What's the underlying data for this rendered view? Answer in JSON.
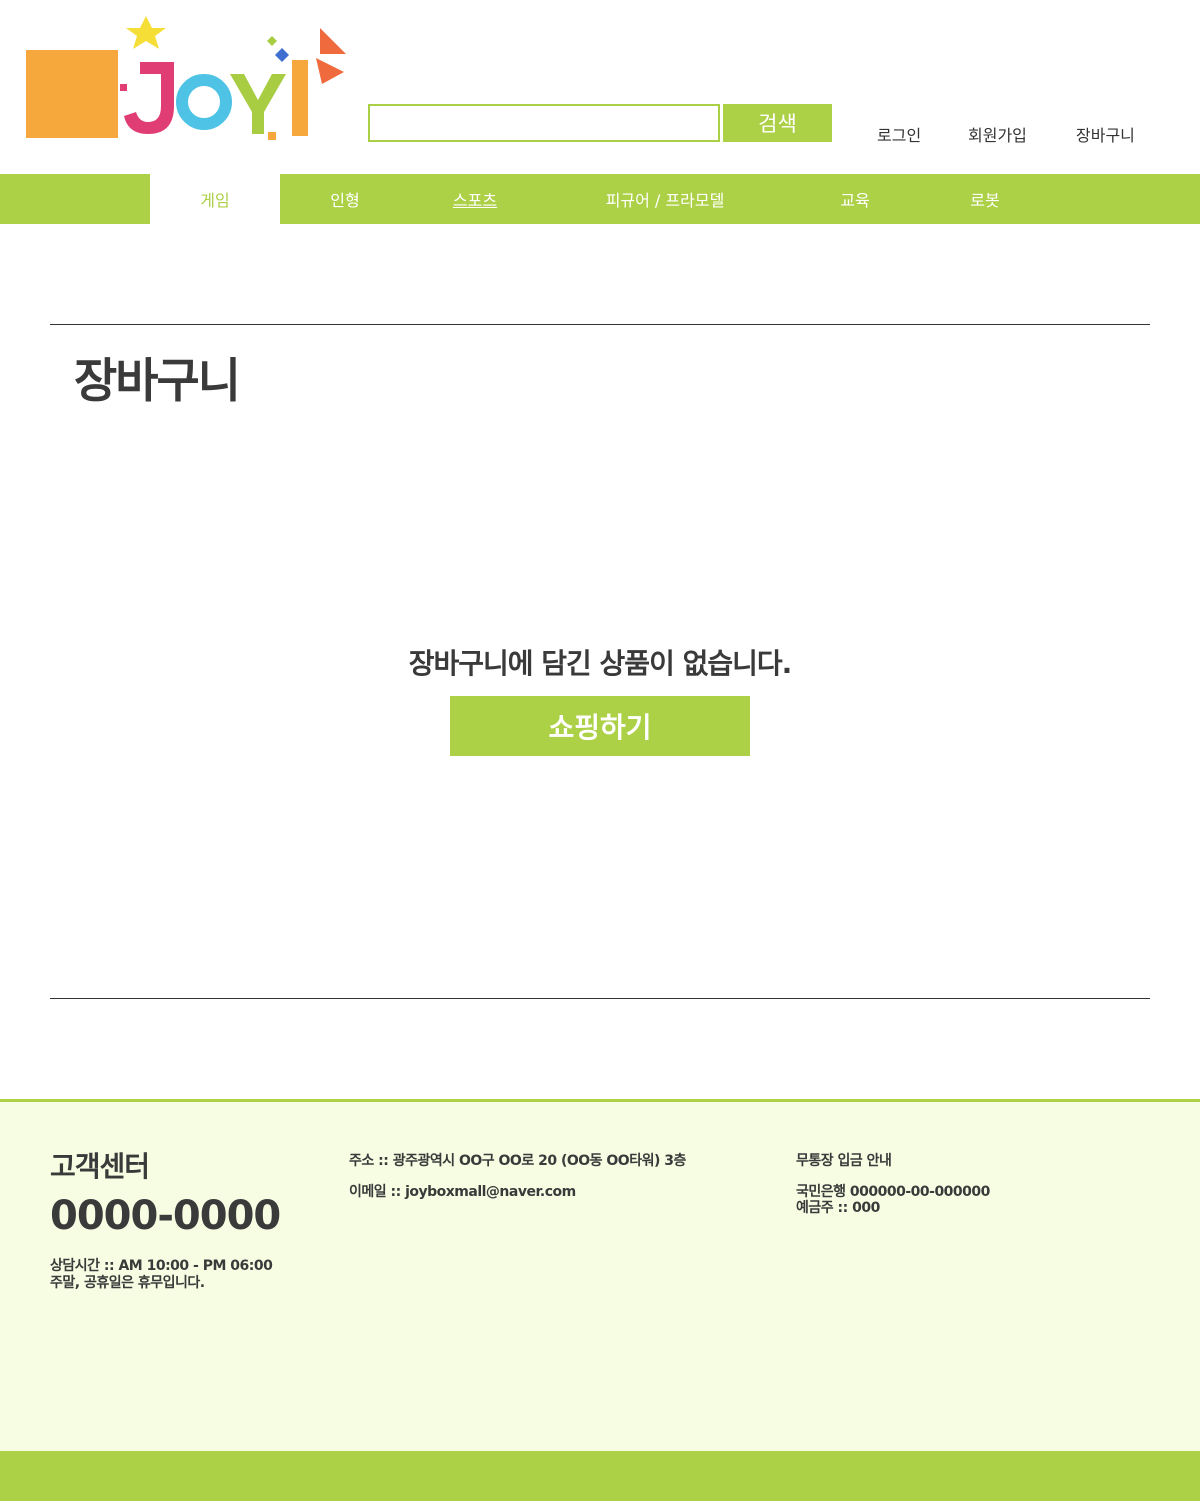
{
  "header": {
    "logo_text": "JOY!",
    "search": {
      "value": "",
      "placeholder": "",
      "button_label": "검색"
    },
    "util_links": [
      "로그인",
      "회원가입",
      "장바구니"
    ]
  },
  "nav": {
    "items": [
      "게임",
      "인형",
      "스포츠",
      "피규어 / 프라모델",
      "교육",
      "로봇"
    ],
    "active": "게임"
  },
  "main": {
    "title": "장바구니",
    "empty_message": "장바구니에 담긴 상품이 없습니다.",
    "shop_button": "쇼핑하기"
  },
  "footer": {
    "cs_title": "고객센터",
    "cs_phone": "0000-0000",
    "hours": "상담시간 :: AM 10:00 - PM 06:00",
    "holiday": "주말, 공휴일은 휴무입니다.",
    "address": "주소 :: 광주광역시 OO구 OO로 20 (OO동 OO타워) 3층",
    "email": "이메일 :: joyboxmall@naver.com",
    "bank_title": "무통장 입금 안내",
    "bank_account": "국민은행 000000-00-000000",
    "account_holder": "예금주 :: 000"
  },
  "colors": {
    "accent": "#acd046",
    "footer_bg": "#f7fde3",
    "text": "#3a3a3a"
  }
}
